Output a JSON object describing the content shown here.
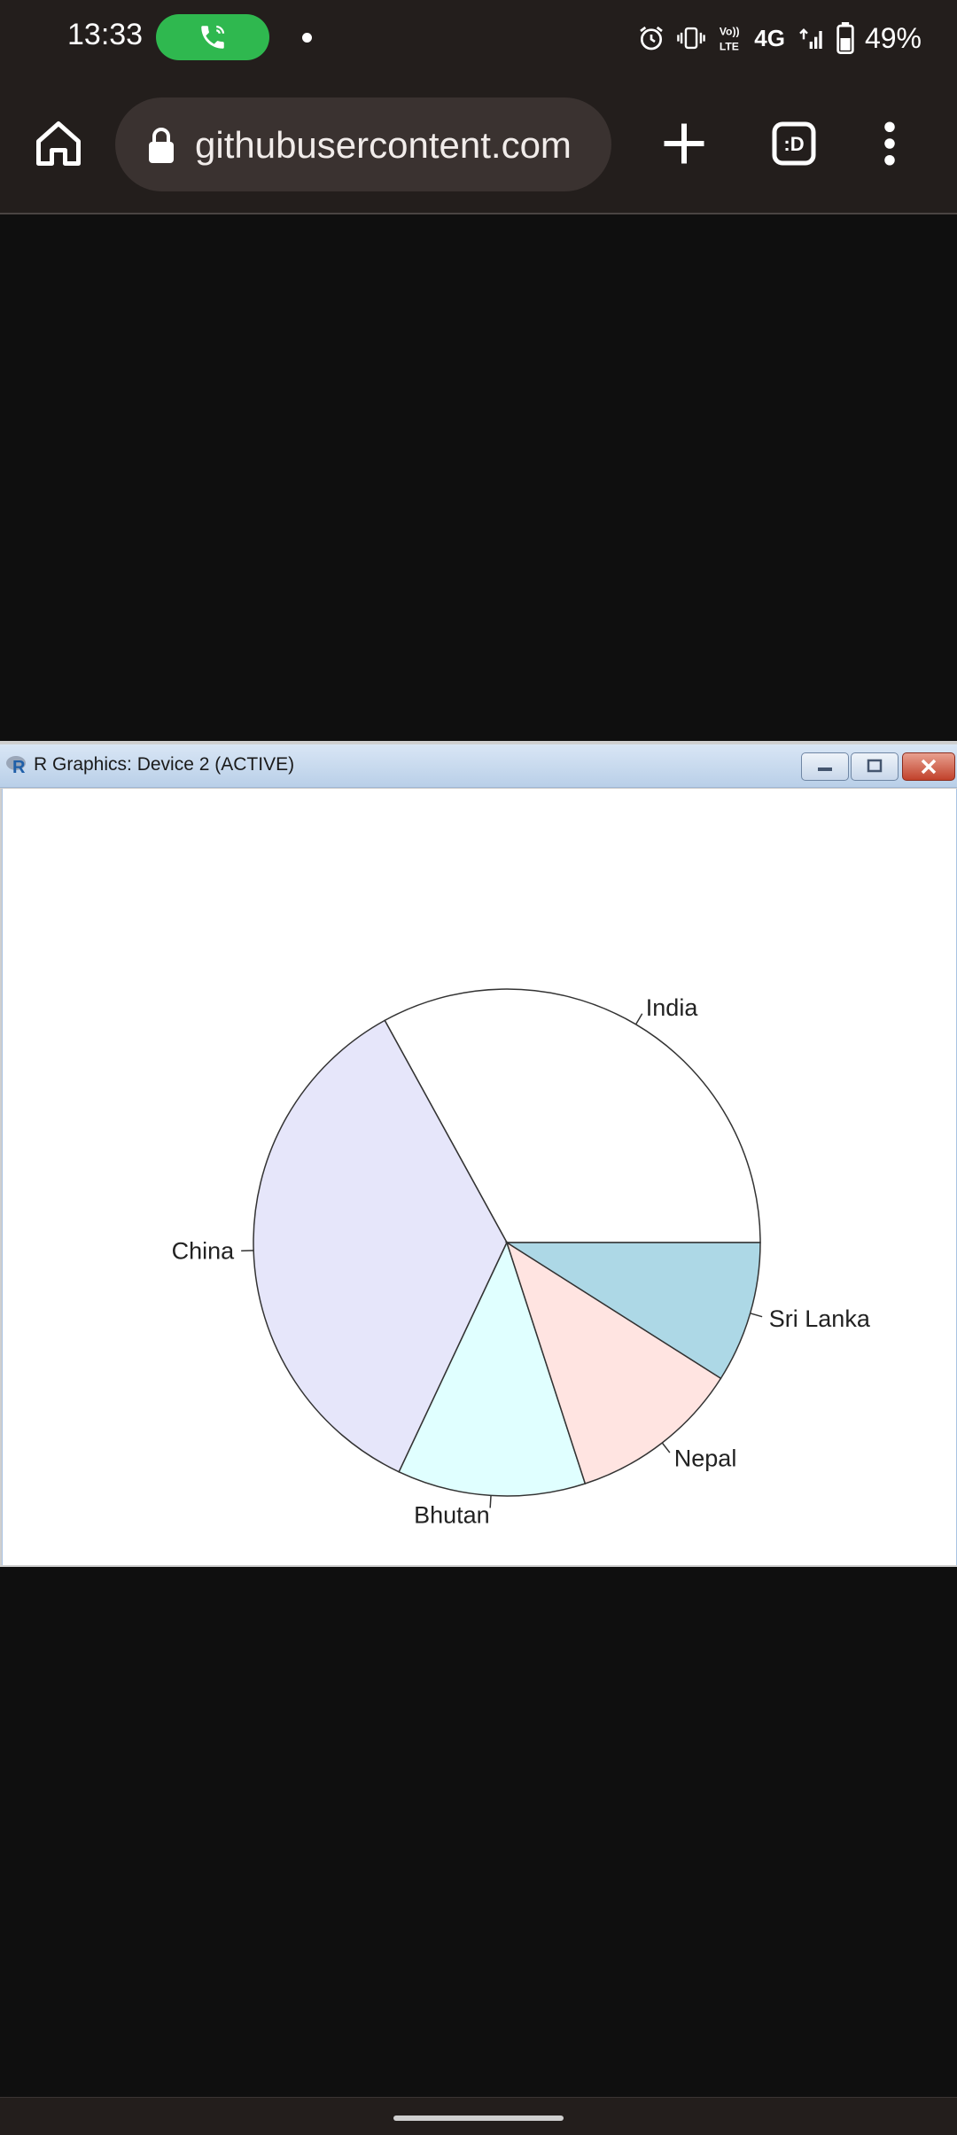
{
  "status_bar": {
    "time": "13:33",
    "network": "4G",
    "battery": "49%"
  },
  "browser": {
    "url": "githubusercontent.com",
    "tab_count_label": ":D"
  },
  "window": {
    "title": "R Graphics: Device 2 (ACTIVE)"
  },
  "chart_data": {
    "type": "pie",
    "categories": [
      "India",
      "China",
      "Bhutan",
      "Nepal",
      "Sri Lanka"
    ],
    "values": [
      33,
      35,
      12,
      11,
      9
    ],
    "colors": [
      "#ffffff",
      "#e6e6fa",
      "#e0ffff",
      "#ffe4e1",
      "#add8e6"
    ],
    "start_angle_deg": 0,
    "direction": "counterclockwise",
    "title": ""
  },
  "colors": {
    "status_bar_bg": "#231e1c",
    "call_pill": "#2fb84f",
    "page_bg": "#0f0f0f"
  }
}
